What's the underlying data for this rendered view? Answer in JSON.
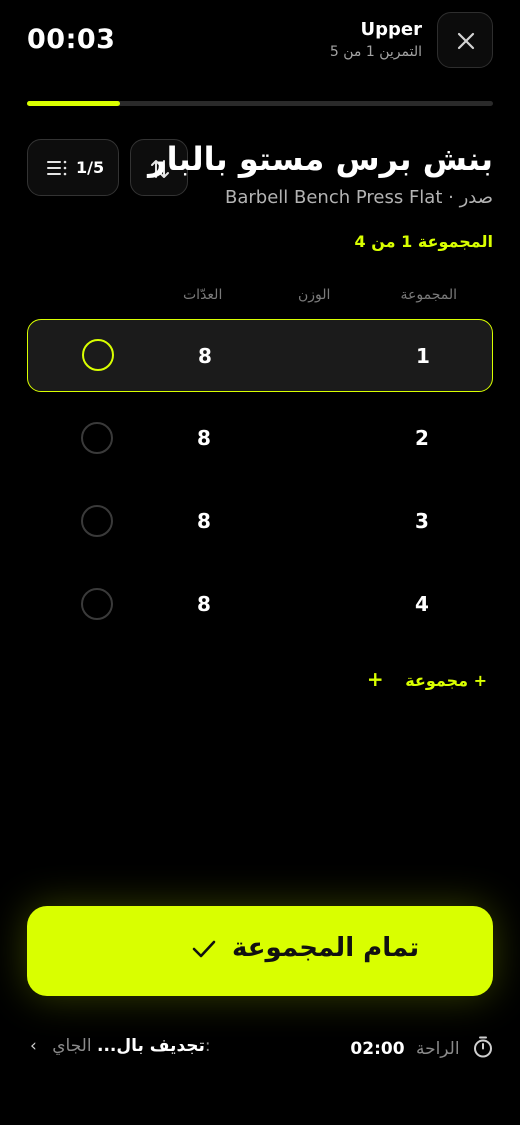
{
  "header": {
    "elapsed_time": "00:03",
    "workout_name": "Upper",
    "workout_progress": "التمرين 1 من 5",
    "progress_fraction": 0.2
  },
  "exercise": {
    "title": "بنش برس مستو بالبار",
    "subtitle": "Barbell Bench Press Flat · صدر",
    "list_counter": "1/5",
    "set_indicator": "المجموعة 1 من 4"
  },
  "table": {
    "headers": {
      "set": "المجموعة",
      "weight": "الوزن",
      "reps": "العدّات"
    },
    "rows": [
      {
        "set": "1",
        "weight": "",
        "reps": "8",
        "active": true
      },
      {
        "set": "2",
        "weight": "",
        "reps": "8",
        "active": false
      },
      {
        "set": "3",
        "weight": "",
        "reps": "8",
        "active": false
      },
      {
        "set": "4",
        "weight": "",
        "reps": "8",
        "active": false
      }
    ]
  },
  "add_set_label": "+ مجموعة",
  "complete_button_label": "تمام المجموعة",
  "footer": {
    "rest_label": "الراحة",
    "rest_time": "02:00",
    "next_label": "الجاي:",
    "next_exercise": "تجديف بال..."
  },
  "colors": {
    "accent": "#d9ff00",
    "background": "#000000"
  },
  "icons": {
    "close": "close-icon",
    "list": "list-icon",
    "swap": "swap-icon",
    "check": "check-icon",
    "timer": "stopwatch-icon",
    "chevron": "chevron-left-icon"
  }
}
